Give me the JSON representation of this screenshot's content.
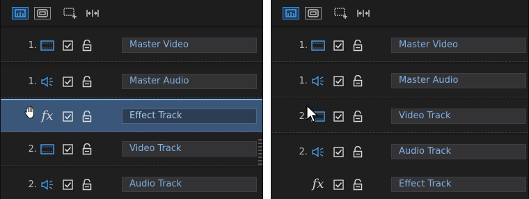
{
  "colors": {
    "accent": "#4a9ae0",
    "panel_bg": "#1f1f20",
    "selected_row": "#3a5678",
    "name_text": "#7fb1e3"
  },
  "toolbar": {
    "icons": [
      "timeline-view-icon",
      "storyboard-view-icon",
      "add-track-icon",
      "fit-timeline-icon"
    ]
  },
  "left_panel": {
    "tracks": [
      {
        "number": "1.",
        "type": "video",
        "name": "Master Video",
        "selected": false
      },
      {
        "number": "1.",
        "type": "audio",
        "name": "Master Audio",
        "selected": false
      },
      {
        "number": "",
        "type": "effect",
        "name": "Effect Track",
        "selected": true,
        "cursor": "hand"
      },
      {
        "number": "2.",
        "type": "video",
        "name": "Video Track",
        "selected": false
      },
      {
        "number": "2.",
        "type": "audio",
        "name": "Audio Track",
        "selected": false
      }
    ]
  },
  "right_panel": {
    "tracks": [
      {
        "number": "1.",
        "type": "video",
        "name": "Master Video",
        "selected": false
      },
      {
        "number": "1.",
        "type": "audio",
        "name": "Master Audio",
        "selected": false
      },
      {
        "number": "2.",
        "type": "video",
        "name": "Video Track",
        "selected": false,
        "cursor": "arrow"
      },
      {
        "number": "2.",
        "type": "audio",
        "name": "Audio Track",
        "selected": false
      },
      {
        "number": "",
        "type": "effect",
        "name": "Effect Track",
        "selected": false
      }
    ]
  },
  "fx_label": "fx"
}
